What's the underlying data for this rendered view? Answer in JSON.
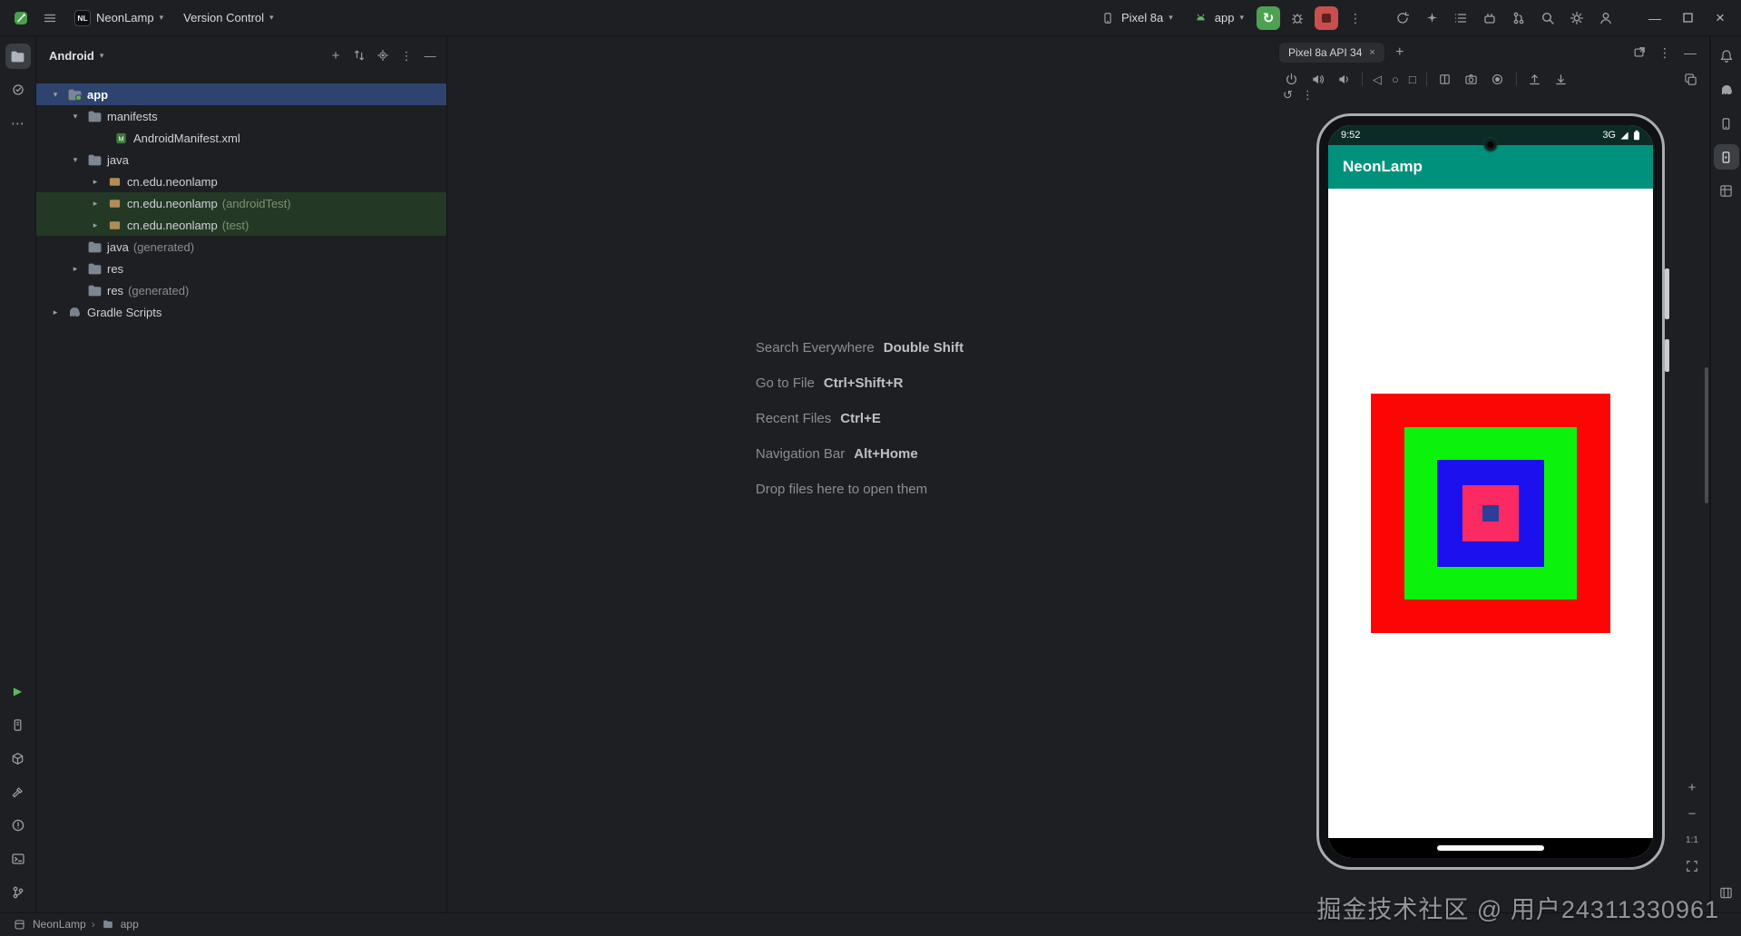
{
  "colors": {
    "selection_blue": "#2e436e",
    "app_bar_teal": "#00917c",
    "run_green": "#4da150",
    "stop_red": "#c94f4e",
    "test_row_green": "#243826"
  },
  "title_bar": {
    "project_badge": "NL",
    "project_name": "NeonLamp",
    "version_control": "Version Control",
    "device": "Pixel 8a",
    "run_config": "app",
    "rerun_glyph": "↻",
    "more_glyph": "⋮",
    "minimize_glyph": "—",
    "close_glyph": "×"
  },
  "project_panel": {
    "mode": "Android",
    "mode_chevron": "▾",
    "hide_glyph": "—",
    "more_glyph": "⋮",
    "plus_glyph": "+",
    "tree": [
      {
        "label": "app",
        "suffix": ""
      },
      {
        "label": "manifests",
        "suffix": ""
      },
      {
        "label": "AndroidManifest.xml",
        "suffix": ""
      },
      {
        "label": "java",
        "suffix": ""
      },
      {
        "label": "cn.edu.neonlamp",
        "suffix": ""
      },
      {
        "label": "cn.edu.neonlamp",
        "suffix": "(androidTest)"
      },
      {
        "label": "cn.edu.neonlamp",
        "suffix": "(test)"
      },
      {
        "label": "java",
        "suffix": "(generated)"
      },
      {
        "label": "res",
        "suffix": ""
      },
      {
        "label": "res",
        "suffix": "(generated)"
      },
      {
        "label": "Gradle Scripts",
        "suffix": ""
      }
    ],
    "chevron_down": "▾",
    "chevron_right": "▸"
  },
  "editor": {
    "shortcuts": [
      {
        "action": "Search Everywhere",
        "keys": "Double Shift"
      },
      {
        "action": "Go to File",
        "keys": "Ctrl+Shift+R"
      },
      {
        "action": "Recent Files",
        "keys": "Ctrl+E"
      },
      {
        "action": "Navigation Bar",
        "keys": "Alt+Home"
      },
      {
        "action": "Drop files here to open them",
        "keys": ""
      }
    ]
  },
  "devices_panel": {
    "tab": "Pixel 8a API 34",
    "tab_close": "×",
    "tab_add": "+",
    "back_glyph": "◁",
    "home_glyph": "○",
    "overview_glyph": "□",
    "reset_glyph": "↺",
    "more_glyph": "⋮",
    "hide_glyph": "—",
    "zoom_in": "+",
    "zoom_out": "−",
    "zoom_label": "1:1",
    "phone": {
      "time": "9:52",
      "network": "3G",
      "app_title": "NeonLamp",
      "squares": [
        {
          "name": "red-square",
          "color": "#fe0505",
          "size": 264
        },
        {
          "name": "green-square",
          "color": "#0bf30b",
          "size": 190
        },
        {
          "name": "blue-square",
          "color": "#1c10ee",
          "size": 118
        },
        {
          "name": "pink-square",
          "color": "#fc2a62",
          "size": 62
        },
        {
          "name": "navy-square",
          "color": "#2c3e97",
          "size": 18
        }
      ]
    }
  },
  "status_bar": {
    "project": "NeonLamp",
    "separator": "›",
    "module": "app"
  },
  "watermark": "掘金技术社区 @ 用户24311330961"
}
